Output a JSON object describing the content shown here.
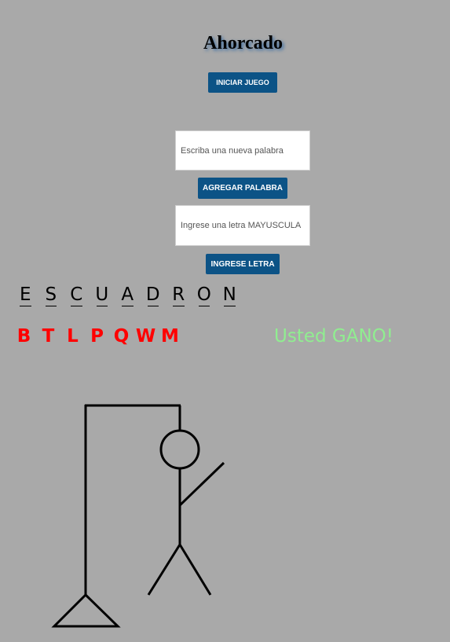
{
  "game": {
    "title": "Ahorcado",
    "start_button": "INICIAR JUEGO",
    "new_word_placeholder": "Escriba una nueva palabra",
    "add_word_button": "AGREGAR PALABRA",
    "letter_placeholder": "Ingrese una letra MAYUSCULA",
    "enter_letter_button": "INGRESE LETRA",
    "word_letters": [
      "E",
      "S",
      "C",
      "U",
      "A",
      "D",
      "R",
      "O",
      "N"
    ],
    "wrong_letters": [
      "B",
      "T",
      "L",
      "P",
      "Q",
      "W",
      "M"
    ],
    "result_message": "Usted GANO!",
    "colors": {
      "background": "#a9a9a9",
      "button": "#0c5386",
      "wrong_letters": "#ff0000",
      "result": "#90ee90"
    }
  }
}
